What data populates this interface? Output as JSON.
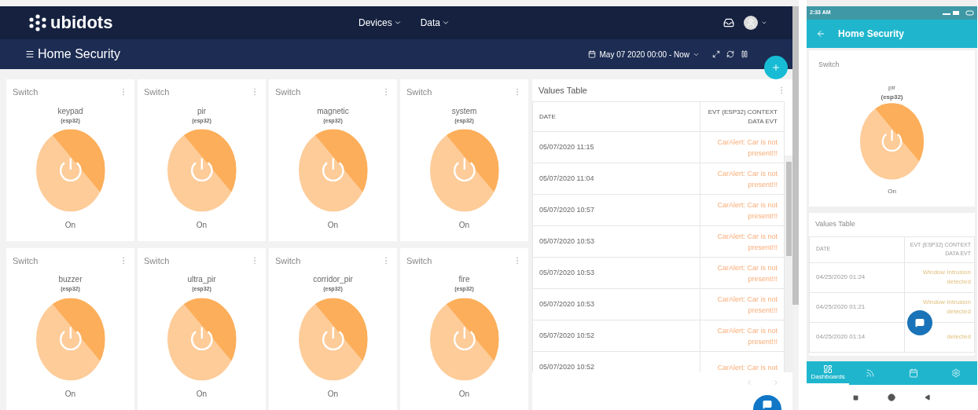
{
  "topbar": {
    "logo": "ubidots",
    "menus": [
      {
        "label": "Devices"
      },
      {
        "label": "Data"
      }
    ]
  },
  "dashbar": {
    "title": "Home Security",
    "date_range": "May 07 2020 00:00 - Now"
  },
  "switches": [
    {
      "title": "Switch",
      "name": "keypad",
      "device": "(esp32)",
      "on": true,
      "state_label": "On"
    },
    {
      "title": "Switch",
      "name": "pir",
      "device": "(esp32)",
      "on": true,
      "state_label": "On"
    },
    {
      "title": "Switch",
      "name": "magnetic",
      "device": "(esp32)",
      "on": true,
      "state_label": "On"
    },
    {
      "title": "Switch",
      "name": "system",
      "device": "(esp32)",
      "on": true,
      "state_label": "On"
    },
    {
      "title": "Switch",
      "name": "buzzer",
      "device": "(esp32)",
      "on": true,
      "state_label": "On"
    },
    {
      "title": "Switch",
      "name": "ultra_pir",
      "device": "(esp32)",
      "on": true,
      "state_label": "On"
    },
    {
      "title": "Switch",
      "name": "corridor_pir",
      "device": "(esp32)",
      "on": true,
      "state_label": "On"
    },
    {
      "title": "Switch",
      "name": "fire",
      "device": "(esp32)",
      "on": true,
      "state_label": "On"
    }
  ],
  "values_table": {
    "title": "Values Table",
    "columns": [
      "DATE",
      "EVT (ESP32) CONTEXT DATA EVT"
    ],
    "rows": [
      {
        "date": "05/07/2020 11:15",
        "value": "CarAlert: Car is not present!!!"
      },
      {
        "date": "05/07/2020 11:04",
        "value": "CarAlert: Car is not present!!!"
      },
      {
        "date": "05/07/2020 10:57",
        "value": "CarAlert: Car is not present!!!"
      },
      {
        "date": "05/07/2020 10:53",
        "value": "CarAlert: Car is not present!!!"
      },
      {
        "date": "05/07/2020 10:53",
        "value": "CarAlert: Car is not present!!!"
      },
      {
        "date": "05/07/2020 10:53",
        "value": "CarAlert: Car is not present!!!"
      },
      {
        "date": "05/07/2020 10:52",
        "value": "CarAlert: Car is not present!!!"
      },
      {
        "date": "05/07/2020 10:52",
        "value": "CarAlert: Car is not"
      }
    ]
  },
  "phone": {
    "time": "2:33 AM",
    "title": "Home Security",
    "switch": {
      "title": "Switch",
      "name": "pir",
      "device": "(esp32)",
      "on": true,
      "state_label": "On"
    },
    "table": {
      "title": "Values Table",
      "columns": [
        "DATE",
        "EVT (ESP32) CONTEXT DATA EVT"
      ],
      "rows": [
        {
          "date": "04/25/2020 01:24",
          "value": "Window Intrusion detected"
        },
        {
          "date": "04/25/2020 01:21",
          "value": "Window Intrusion detected"
        },
        {
          "date": "04/25/2020 01:14",
          "value": "detected"
        }
      ]
    },
    "nav": [
      {
        "kind": "dashboards",
        "label": "Dashboards",
        "selected": true
      },
      {
        "kind": "feed",
        "selected": false
      },
      {
        "kind": "calendar",
        "selected": false
      },
      {
        "kind": "settings",
        "selected": false
      }
    ]
  }
}
